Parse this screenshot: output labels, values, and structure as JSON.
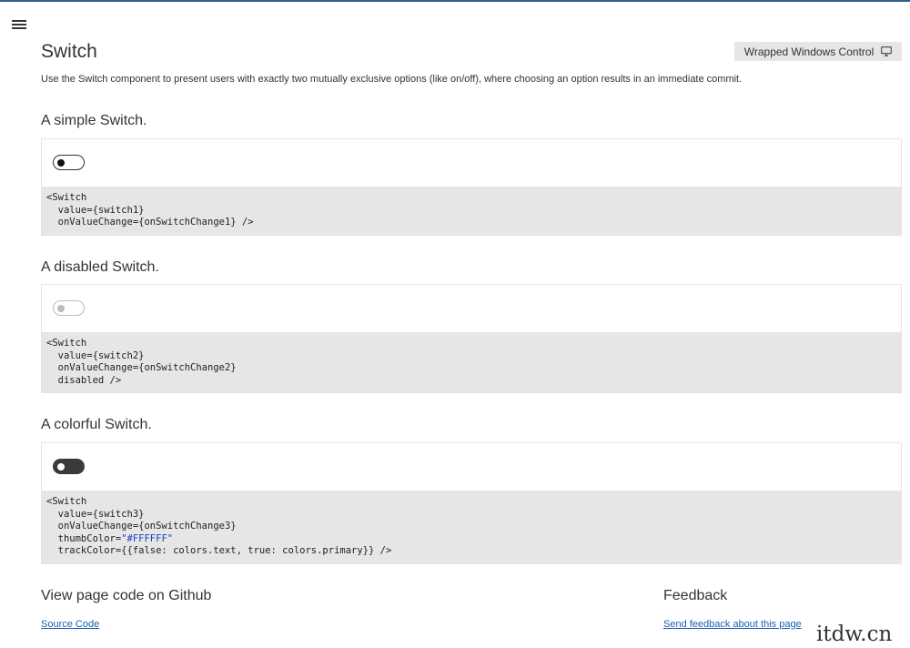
{
  "page": {
    "title": "Switch",
    "description": "Use the Switch component to present users with exactly two mutually exclusive options (like on/off), where choosing an option results in an immediate commit.",
    "wrapped_button_label": "Wrapped Windows Control"
  },
  "sections": [
    {
      "heading": "A simple Switch.",
      "switch_state": "off",
      "code": [
        "<Switch",
        "  value={switch1}",
        "  onValueChange={onSwitchChange1} />"
      ]
    },
    {
      "heading": "A disabled Switch.",
      "switch_state": "disabled",
      "code": [
        "<Switch",
        "  value={switch2}",
        "  onValueChange={onSwitchChange2}",
        "  disabled />"
      ]
    },
    {
      "heading": "A colorful Switch.",
      "switch_state": "off",
      "code": [
        "<Switch",
        "  value={switch3}",
        "  onValueChange={onSwitchChange3}",
        "  thumbColor=",
        "\"#FFFFFF\"",
        "  trackColor={{false: colors.text, true: colors.primary}} />"
      ]
    }
  ],
  "footer": {
    "github_heading": "View page code on Github",
    "source_link": "Source Code",
    "feedback_heading": "Feedback",
    "feedback_link": "Send feedback about this page"
  },
  "watermark": "itdw.cn",
  "colors": {
    "top_border": "#2f5f8a",
    "code_bg": "#e6e6e6",
    "link": "#1a5fb4",
    "string_literal": "#1a3fb8",
    "colorful_track": "#3a3a3a",
    "colorful_thumb": "#FFFFFF"
  },
  "icons": {
    "menu": "hamburger-menu-icon",
    "wrapped": "monitor-icon"
  }
}
